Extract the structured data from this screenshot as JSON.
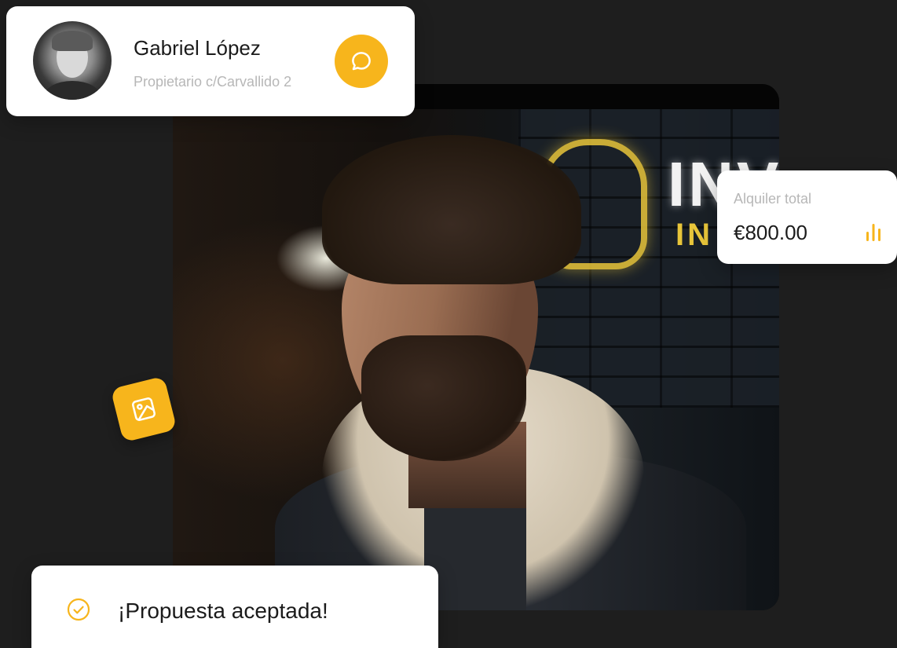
{
  "profile": {
    "name": "Gabriel López",
    "subtitle": "Propietario c/Carvallido 2"
  },
  "rent": {
    "label": "Alquiler total",
    "value": "€800.00"
  },
  "status": {
    "message": "¡Propuesta aceptada!"
  },
  "photo": {
    "sign_text_1": "INV",
    "sign_text_2": "IN"
  },
  "icons": {
    "chat": "chat-bubble-icon",
    "chart": "bar-chart-icon",
    "check": "check-circle-icon",
    "image": "image-icon"
  },
  "colors": {
    "accent": "#f7b51c",
    "background": "#1e1e1e",
    "card": "#ffffff",
    "text_primary": "#1b1b1b",
    "text_secondary": "#b7b7b7"
  }
}
